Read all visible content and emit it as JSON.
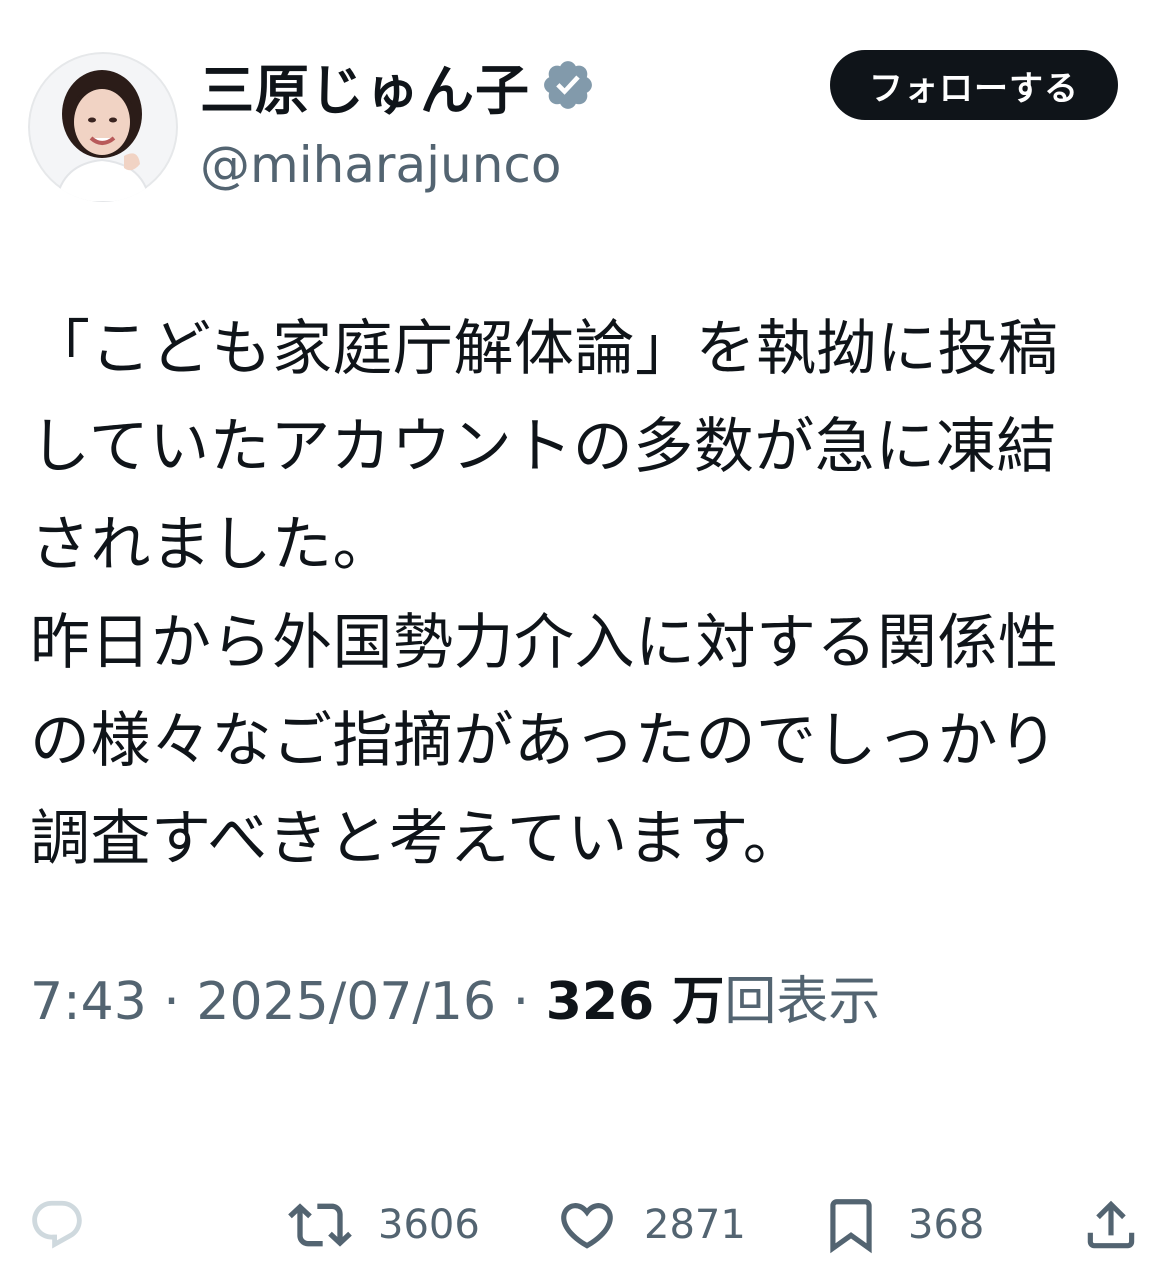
{
  "author": {
    "display_name": "三原じゅん子",
    "handle": "@miharajunco",
    "verified_color": "#829aab"
  },
  "follow_button": {
    "label": "フォローする"
  },
  "tweet": {
    "lines": [
      "「こども家庭庁解体論」を執拗に投稿",
      "していたアカウントの多数が急に凍結",
      "されました。",
      "昨日から外国勢力介入に対する関係性",
      "の様々なご指摘があったのでしっかり",
      "調査すべきと考えています。"
    ]
  },
  "meta": {
    "time": "7:43",
    "separator": " · ",
    "date": "2025/07/16",
    "views_count": "326 万",
    "views_label": "回表示"
  },
  "actions": {
    "reply": {
      "icon": "reply-icon",
      "count": ""
    },
    "retweet": {
      "icon": "retweet-icon",
      "count": "3606"
    },
    "like": {
      "icon": "heart-icon",
      "count": "2871"
    },
    "bookmark": {
      "icon": "bookmark-icon",
      "count": "368"
    },
    "share": {
      "icon": "share-icon"
    }
  },
  "colors": {
    "text": "#0f1419",
    "secondary": "#536471",
    "reply_icon_faded": "#cfd9de",
    "button_bg": "#0f1419"
  }
}
